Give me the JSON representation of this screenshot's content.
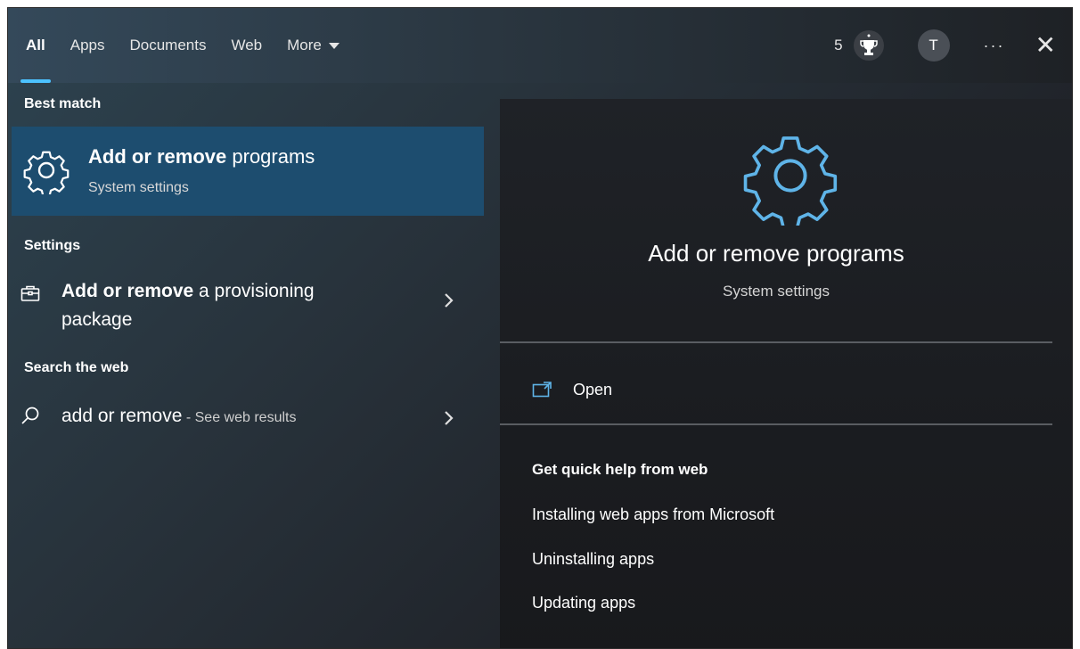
{
  "tabs": [
    {
      "label": "All",
      "active": true
    },
    {
      "label": "Apps"
    },
    {
      "label": "Documents"
    },
    {
      "label": "Web"
    },
    {
      "label": "More"
    }
  ],
  "header": {
    "reward_count": "5",
    "avatar_initial": "T",
    "more_dots": "···",
    "close": "✕"
  },
  "left": {
    "best_match_heading": "Best match",
    "best_match": {
      "title_bold": "Add or remove",
      "title_rest": " programs",
      "subtitle": "System settings",
      "icon": "gear-icon"
    },
    "settings_heading": "Settings",
    "settings_item": {
      "title_bold": "Add or remove",
      "title_rest": " a provisioning",
      "title_line2": "package",
      "icon": "briefcase-icon"
    },
    "web_heading": "Search the web",
    "web_item": {
      "query": "add or remove",
      "suffix": " - See web results",
      "icon": "search-icon"
    }
  },
  "right": {
    "title": "Add or remove programs",
    "subtitle": "System settings",
    "open_label": "Open",
    "help_heading": "Get quick help from web",
    "help_links": [
      "Installing web apps from Microsoft",
      "Uninstalling apps",
      "Updating apps"
    ]
  },
  "colors": {
    "accent": "#4cc2ff",
    "selected_row": "#1d4d6f",
    "gear_blue": "#5fb4e8"
  }
}
